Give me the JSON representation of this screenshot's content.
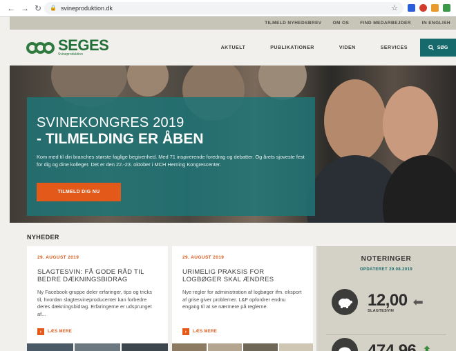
{
  "browser": {
    "url": "svineproduktion.dk",
    "back_icon": "arrow-left-icon",
    "forward_icon": "arrow-right-icon",
    "reload_icon": "reload-icon"
  },
  "utility_nav": [
    "TILMELD NYHEDSBREV",
    "OM OS",
    "FIND MEDARBEJDER",
    "IN ENGLISH"
  ],
  "logo": {
    "brand": "SEGES",
    "sub": "Svineproduktion"
  },
  "main_nav": [
    "AKTUELT",
    "PUBLIKATIONER",
    "VIDEN",
    "SERVICES"
  ],
  "search": {
    "label": "SØG"
  },
  "hero": {
    "title_line1": "SVINEKONGRES 2019",
    "title_line2": "- TILMELDING ER ÅBEN",
    "description": "Kom med til din branches største faglige begivenhed. Med 71 inspirerende foredrag og debatter. Og årets sjoveste fest for dig og dine kolleger. Det er den 22.-23. oktober i MCH Herning Kongrescenter.",
    "button": "TILMELD DIG NU"
  },
  "news": {
    "heading": "NYHEDER",
    "more_label": "LÆS MERE",
    "items": [
      {
        "date": "29. AUGUST 2019",
        "title": "SLAGTESVIN: FÅ GODE RÅD TIL BEDRE DÆKNINGSBIDRAG",
        "body": "Ny Facebook-gruppe deler erfaringer, tips og tricks til, hvordan slagtesvineproducenter kan forbedre deres dækningsbidrag. Erfaringerne er udsprunget af..."
      },
      {
        "date": "29. AUGUST 2019",
        "title": "URIMELIG PRAKSIS FOR LOGBØGER SKAL ÆNDRES",
        "body": "Nye regler for administration af logbøger ifm. eksport af grise giver problemer. L&F opfordrer endnu engang til at se nærmere på reglerne."
      }
    ]
  },
  "noteringer": {
    "heading": "NOTERINGER",
    "updated": "OPDATERET 29.08.2019",
    "rows": [
      {
        "value": "12,00",
        "label": "SLAGTESVIN",
        "trend": "flat"
      },
      {
        "value": "474,96",
        "label": "",
        "trend": "up"
      }
    ]
  },
  "colors": {
    "brand_green": "#236f37",
    "teal": "#166a6c",
    "orange": "#e2591a"
  }
}
